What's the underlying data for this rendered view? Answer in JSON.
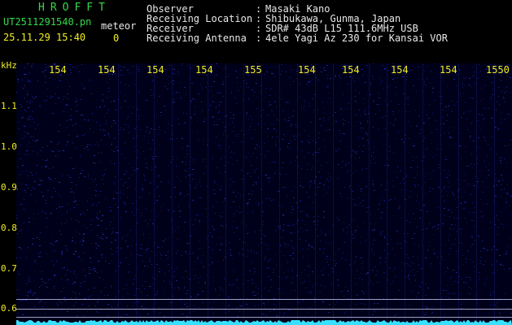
{
  "header": {
    "app_name": "HROFFT",
    "file_label": "UT2511291540.pn",
    "meteor_label": "meteor",
    "datetime": "25.11.29 15:40",
    "count": "0"
  },
  "meta": [
    {
      "key": "Observer",
      "sep": ":",
      "value": "Masaki Kano"
    },
    {
      "key": "Receiving Location",
      "sep": ":",
      "value": "Shibukawa, Gunma, Japan"
    },
    {
      "key": "Receiver",
      "sep": ":",
      "value": "SDR# 43dB L15 111.6MHz USB"
    },
    {
      "key": "Receiving Antenna",
      "sep": ":",
      "value": "4ele Yagi Az 230 for Kansai VOR"
    }
  ],
  "spectrogram": {
    "y_unit": "kHz",
    "x_ticks": [
      "154",
      "154",
      "154",
      "154",
      "155",
      "154",
      "154",
      "154",
      "154",
      "1550"
    ],
    "y_ticks": [
      "1.1",
      "1.0",
      "0.9",
      "0.8",
      "0.7",
      "0.6"
    ],
    "colors": {
      "background": "#000000",
      "noise": "#1e2bb0",
      "trace": "#37e0ff",
      "axis_text": "#f2ee21",
      "header_green": "#34d94a"
    }
  }
}
